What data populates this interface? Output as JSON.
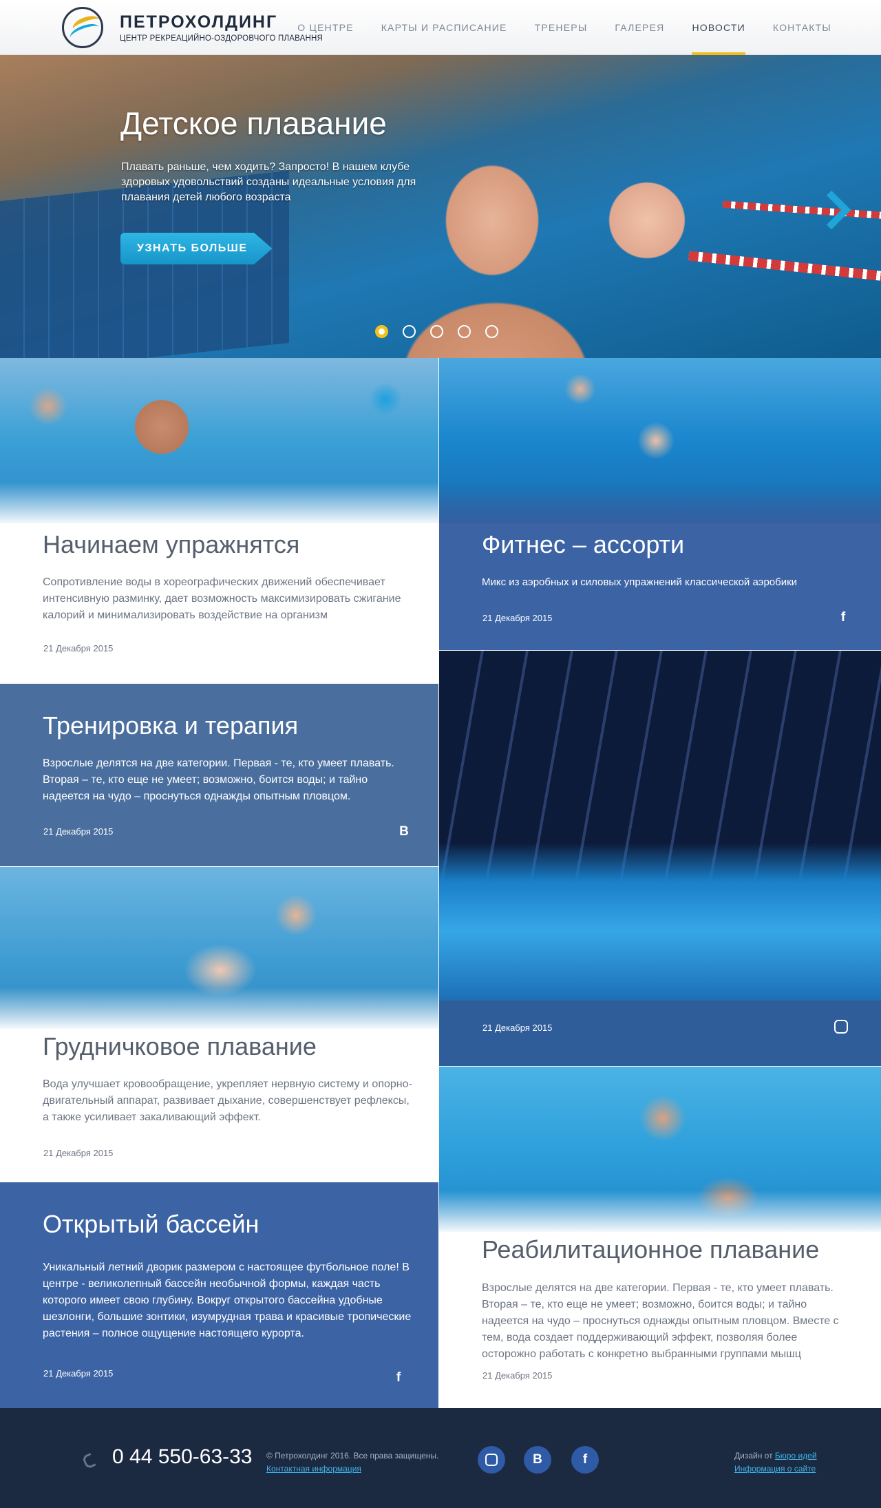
{
  "header": {
    "logo_name": "ПЕТРОХОЛДИНГ",
    "logo_subtitle": "ЦЕНТР РЕКРЕАЦИЙНО-ОЗДОРОВЧОГО ПЛАВАННЯ",
    "nav": [
      {
        "label": "О ЦЕНТРЕ"
      },
      {
        "label": "КАРТЫ И РАСПИСАНИЕ"
      },
      {
        "label": "ТРЕНЕРЫ"
      },
      {
        "label": "ГАЛЕРЕЯ"
      },
      {
        "label": "НОВОСТИ",
        "active": true
      },
      {
        "label": "КОНТАКТЫ"
      }
    ]
  },
  "hero": {
    "title": "Детское плавание",
    "text": "Плавать раньше, чем ходить? Запросто! В нашем клубе здоровых удовольствий созданы идеальные условия для плавания детей любого возраста",
    "button": "УЗНАТЬ БОЛЬШЕ",
    "slides_count": 5,
    "active_slide": 1
  },
  "cards": [
    {
      "title": "Начинаем упражнятся",
      "text": "Сопротивление воды в хореографических движений обеспечивает интенсивную разминку, дает возможность максимизировать сжигание калорий и минимализировать воздействие на организм",
      "date": "21 Декабря 2015",
      "social": ""
    },
    {
      "title": "Фитнес – ассорти",
      "text": "Микс из аэробных и силовых упражнений классической аэробики",
      "date": "21 Декабря 2015",
      "social": "facebook-icon"
    },
    {
      "title": "Тренировка и терапия",
      "text": "Взрослые делятся на две категории. Первая - те, кто умеет плавать. Вторая – те, кто еще не умеет; возможно, боится воды; и тайно надеется на чудо – проснуться однажды опытным пловцом.",
      "date": "21 Декабря 2015",
      "social": "vk-icon"
    },
    {
      "title": "",
      "text": "",
      "date": "21 Декабря 2015",
      "social": "instagram-icon"
    },
    {
      "title": "Грудничковое плавание",
      "text": "Вода улучшает кровообращение, укрепляет нервную систему и опорно-двигательный аппарат, развивает дыхание, совершенствует рефлексы, а также усиливает закаливающий эффект.",
      "date": "21 Декабря 2015",
      "social": ""
    },
    {
      "title": "Открытый бассейн",
      "text": "Уникальный летний дворик размером с настоящее футбольное поле! В центре - великолепный бассейн необычной формы, каждая часть которого имеет свою глубину. Вокруг открытого бассейна удобные шезлонги, большие зонтики, изумрудная трава и красивые тропические растения – полное ощущение настоящего курорта.",
      "date": "21 Декабря 2015",
      "social": "facebook-icon"
    },
    {
      "title": "Реабилитационное плавание",
      "text": "Взрослые делятся на две категории. Первая - те, кто умеет плавать. Вторая – те, кто еще не умеет; возможно, боится воды; и тайно надеется на чудо – проснуться однажды опытным пловцом. Вместе с тем, вода создает поддерживающий эффект, позволяя более осторожно работать с конкретно выбранными группами мышц",
      "date": "21 Декабря 2015",
      "social": ""
    }
  ],
  "footer": {
    "phone": "0 44 550-63-33",
    "copyright": "© Петрохолдинг 2016. Все права защищены.",
    "contact_link": "Контактная информация",
    "design_prefix": "Дизайн от ",
    "design_link": "Бюро идей",
    "about_link": "Информация о сайте",
    "social_icons": [
      "instagram-icon",
      "vk-icon",
      "facebook-icon"
    ]
  },
  "colors": {
    "accent_yellow": "#f1bc1c",
    "accent_cyan": "#1fa5d8",
    "card_blue": "#3c63a4",
    "footer_bg": "#1c2a41"
  }
}
